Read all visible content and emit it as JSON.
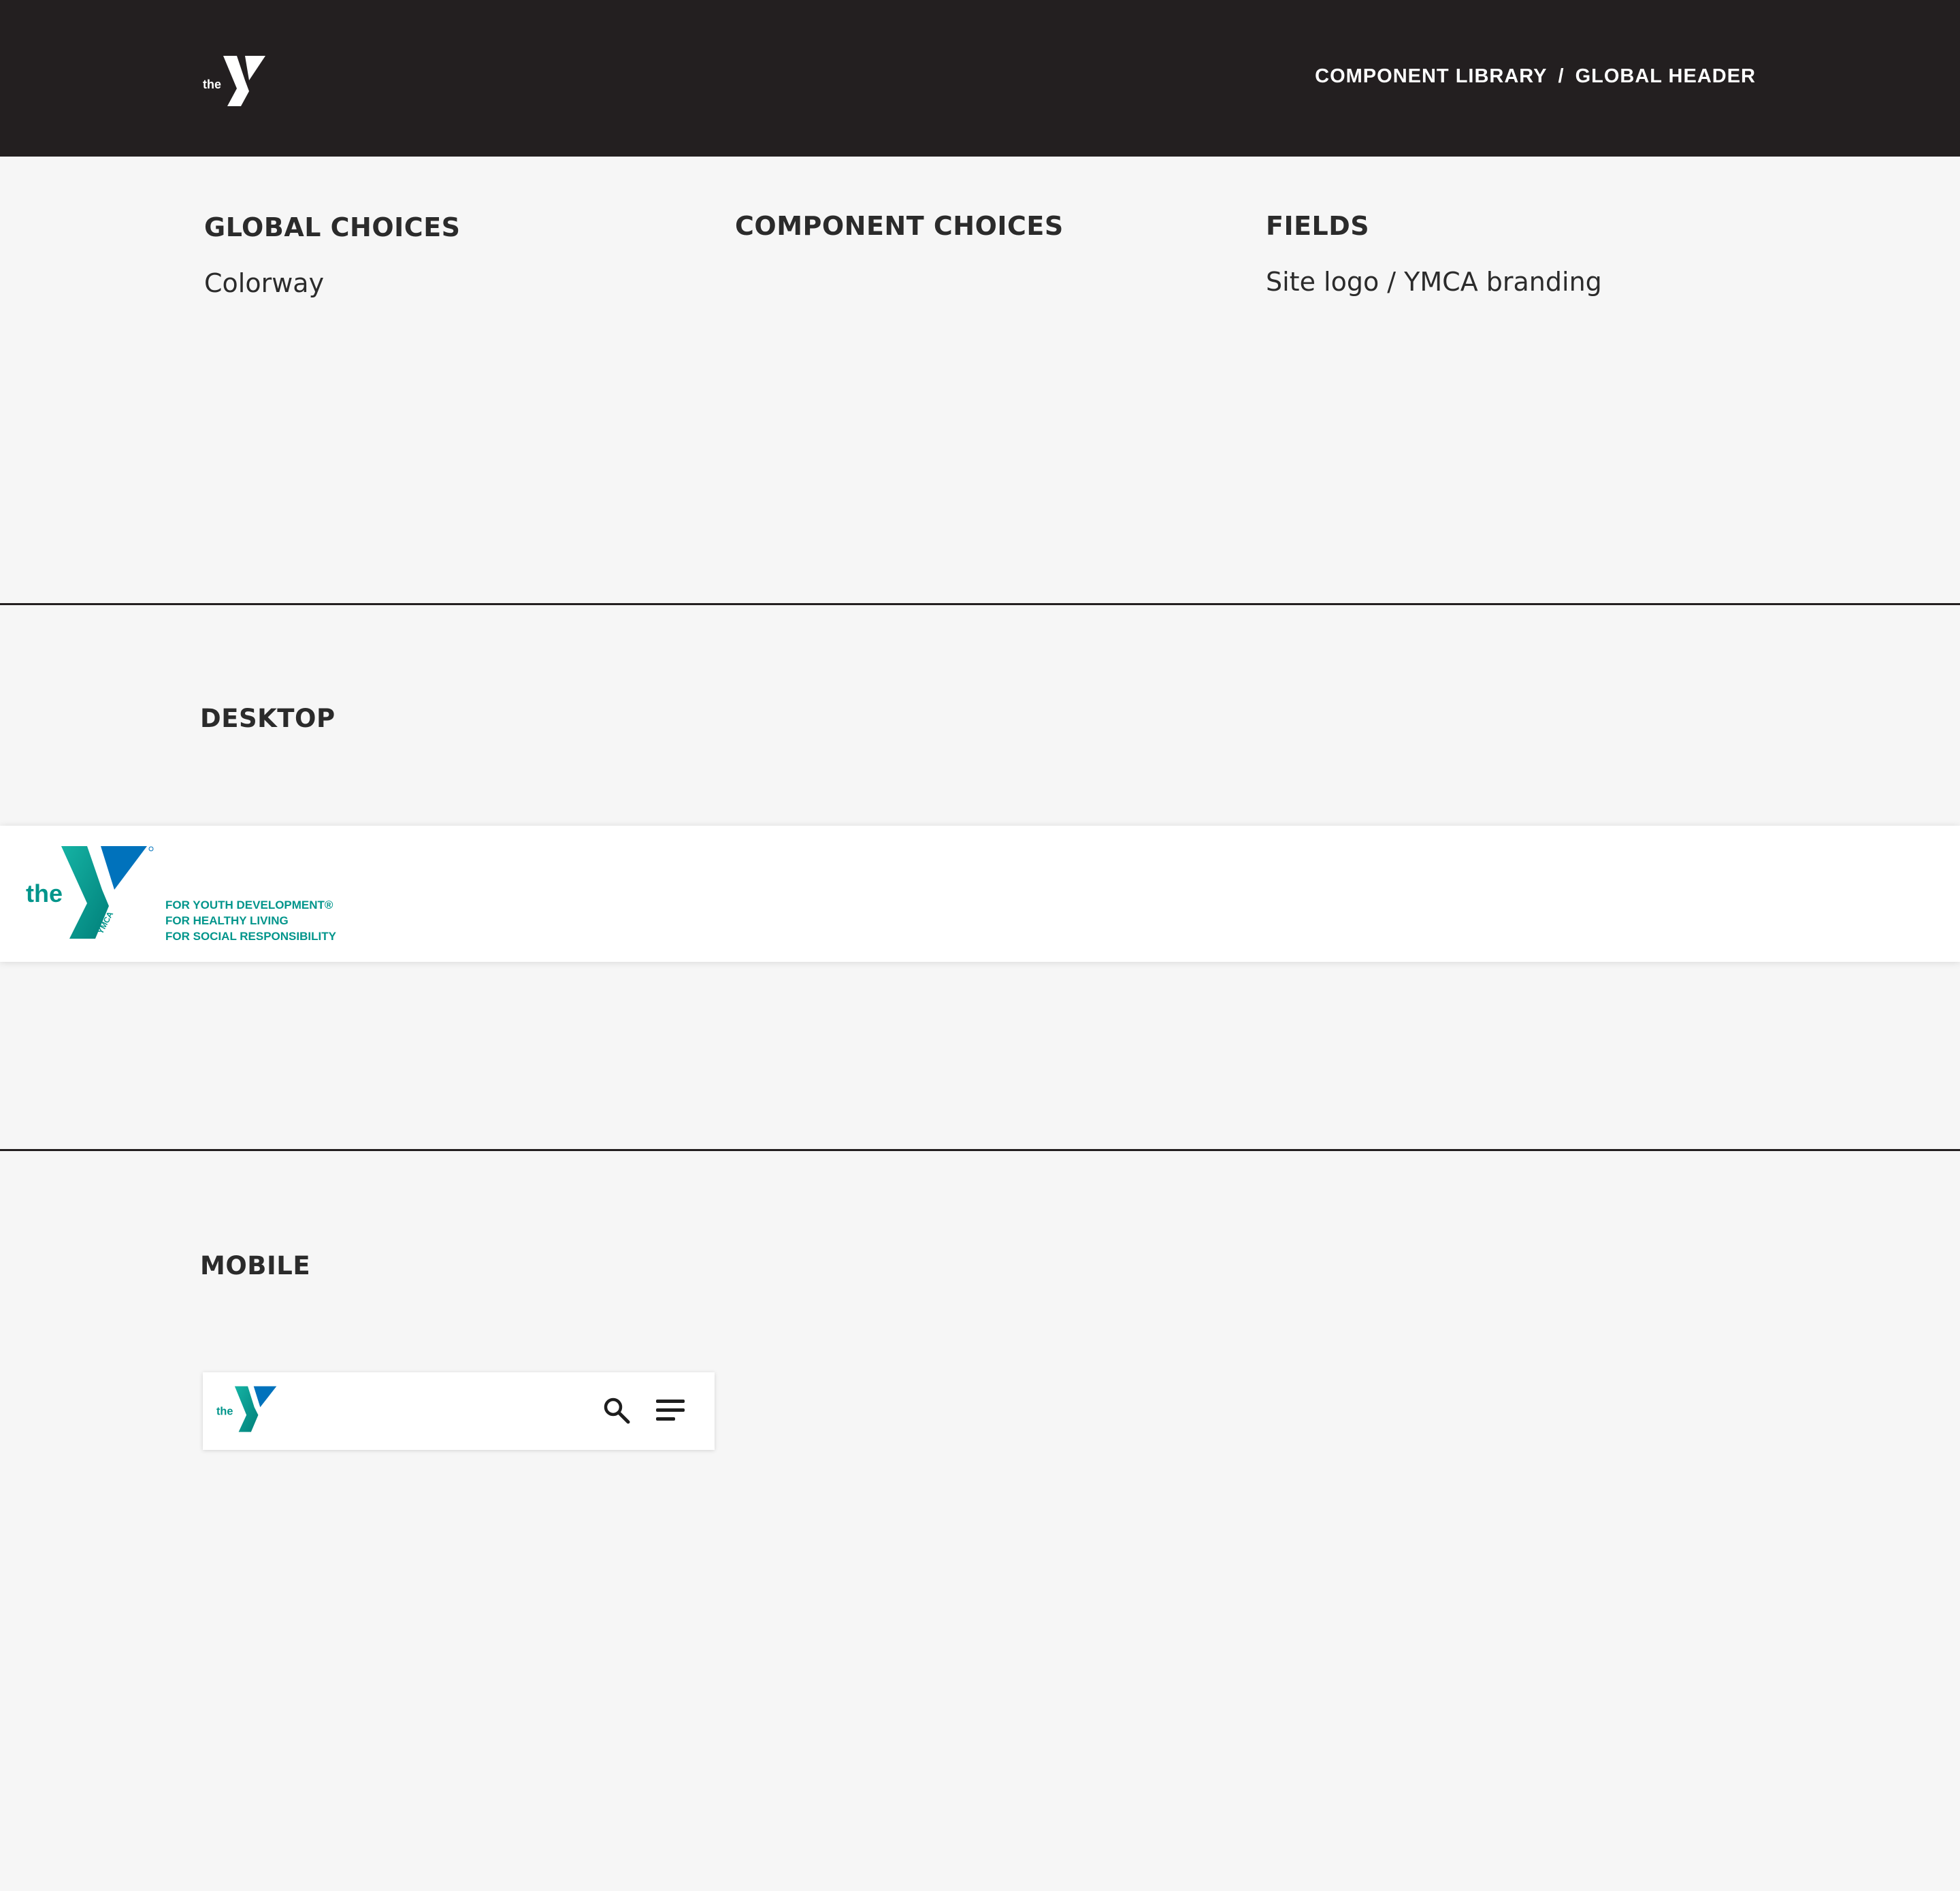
{
  "app": {
    "logo_icon": "ymca-logo-white",
    "breadcrumb": {
      "library": "COMPONENT LIBRARY",
      "separator": "/",
      "current": "GLOBAL HEADER"
    }
  },
  "columns": {
    "global": {
      "heading": "GLOBAL CHOICES",
      "item": "Colorway"
    },
    "component": {
      "heading": "COMPONENT CHOICES"
    },
    "fields": {
      "heading": "FIELDS",
      "item": "Site logo / YMCA branding"
    }
  },
  "desktop": {
    "title": "DESKTOP",
    "logo_icon": "ymca-logo-color",
    "tagline": [
      "FOR YOUTH DEVELOPMENT®",
      "FOR HEALTHY LIVING",
      "FOR SOCIAL RESPONSIBILITY"
    ]
  },
  "mobile": {
    "title": "MOBILE",
    "logo_icon": "ymca-logo-color",
    "search_icon": "search-icon",
    "menu_icon": "hamburger-menu-icon"
  },
  "colors": {
    "topbar": "#231f20",
    "page_bg": "#f6f6f6",
    "brand_teal": "#01958b",
    "brand_blue": "#0072bc",
    "text": "#2b2b2b"
  }
}
